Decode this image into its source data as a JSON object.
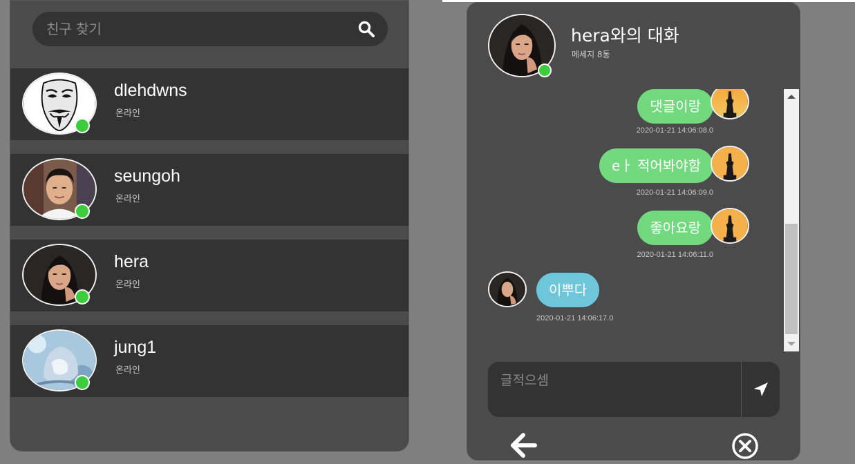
{
  "search": {
    "placeholder": "친구 찾기"
  },
  "friends": [
    {
      "name": "dlehdwns",
      "status": "온라인"
    },
    {
      "name": "seungoh",
      "status": "온라인"
    },
    {
      "name": "hera",
      "status": "온라인"
    },
    {
      "name": "jung1",
      "status": "온라인"
    }
  ],
  "chat": {
    "title": "hera와의 대화",
    "subtitle": "메세지 8통",
    "messages": [
      {
        "text": "댓글이랑",
        "time": "2020-01-21 14:06:08.0",
        "from": "me"
      },
      {
        "text": "eㅏ 적어봐야함",
        "time": "2020-01-21 14:06:09.0",
        "from": "me"
      },
      {
        "text": "좋아요랑",
        "time": "2020-01-21 14:06:11.0",
        "from": "me"
      },
      {
        "text": "이뿌다",
        "time": "2020-01-21 14:06:17.0",
        "from": "hera"
      }
    ],
    "composer_placeholder": "글적으셈"
  },
  "colors": {
    "online": "#3ccc3c",
    "my_bubble": "#72d97f",
    "their_bubble": "#6ec6da",
    "panel": "#4b4b4b",
    "row": "#333333"
  },
  "icons": [
    "search-icon",
    "send-icon",
    "back-arrow-icon",
    "close-circle-icon"
  ]
}
